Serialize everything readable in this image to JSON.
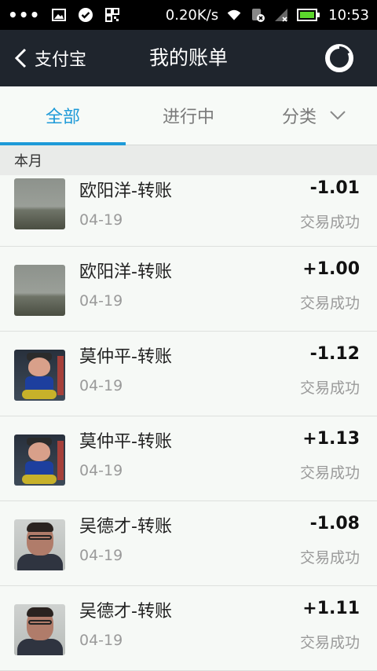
{
  "status_bar": {
    "network_speed": "0.20K/s",
    "time": "10:53",
    "icons": [
      "more-dots-icon",
      "image-icon",
      "check-circle-icon",
      "qr-icon",
      "wifi-icon",
      "sim-icon",
      "signal-icon",
      "battery-icon"
    ]
  },
  "appbar": {
    "back_label": "支付宝",
    "title": "我的账单",
    "right_icon": "pie-chart-icon"
  },
  "tabs": [
    {
      "label": "全部",
      "active": true
    },
    {
      "label": "进行中",
      "active": false
    },
    {
      "label": "分类",
      "active": false
    }
  ],
  "section": {
    "label": "本月"
  },
  "transactions": [
    {
      "name": "欧阳洋-转账",
      "date": "04-19",
      "amount": "-1.01",
      "status": "交易成功",
      "avatar": "lake"
    },
    {
      "name": "欧阳洋-转账",
      "date": "04-19",
      "amount": "+1.00",
      "status": "交易成功",
      "avatar": "lake"
    },
    {
      "name": "莫仲平-转账",
      "date": "04-19",
      "amount": "-1.12",
      "status": "交易成功",
      "avatar": "toy"
    },
    {
      "name": "莫仲平-转账",
      "date": "04-19",
      "amount": "+1.13",
      "status": "交易成功",
      "avatar": "toy"
    },
    {
      "name": "吴德才-转账",
      "date": "04-19",
      "amount": "-1.08",
      "status": "交易成功",
      "avatar": "man"
    },
    {
      "name": "吴德才-转账",
      "date": "04-19",
      "amount": "+1.11",
      "status": "交易成功",
      "avatar": "man"
    }
  ],
  "colors": {
    "accent": "#1e9ad8",
    "appbar": "#1f252d",
    "battery": "#5cd62c"
  }
}
